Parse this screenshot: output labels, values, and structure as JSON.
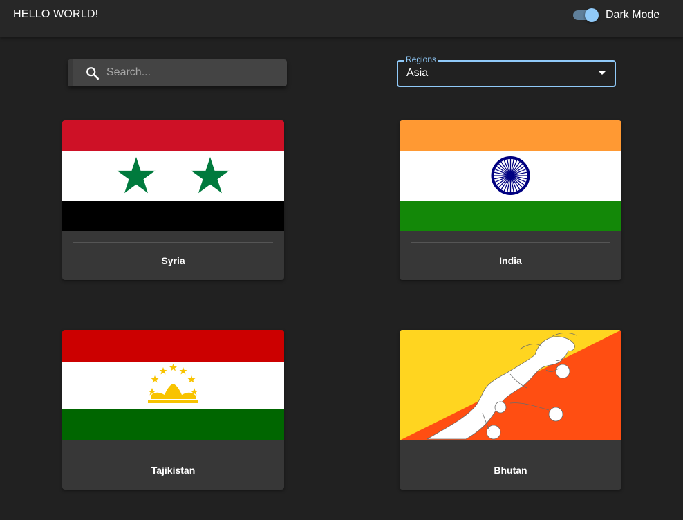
{
  "app": {
    "title": "HELLO WORLD!",
    "dark_mode_label": "Dark Mode",
    "dark_mode_on": true
  },
  "search": {
    "placeholder": "Search..."
  },
  "region_select": {
    "label": "Regions",
    "selected": "Asia"
  },
  "countries": [
    {
      "name": "Syria",
      "flag": "syria-flag"
    },
    {
      "name": "India",
      "flag": "india-flag"
    },
    {
      "name": "Tajikistan",
      "flag": "tajikistan-flag"
    },
    {
      "name": "Bhutan",
      "flag": "bhutan-flag"
    }
  ],
  "colors": {
    "background": "#212121",
    "appbar": "#272727",
    "card": "#373737",
    "accent": "#90caf9"
  }
}
